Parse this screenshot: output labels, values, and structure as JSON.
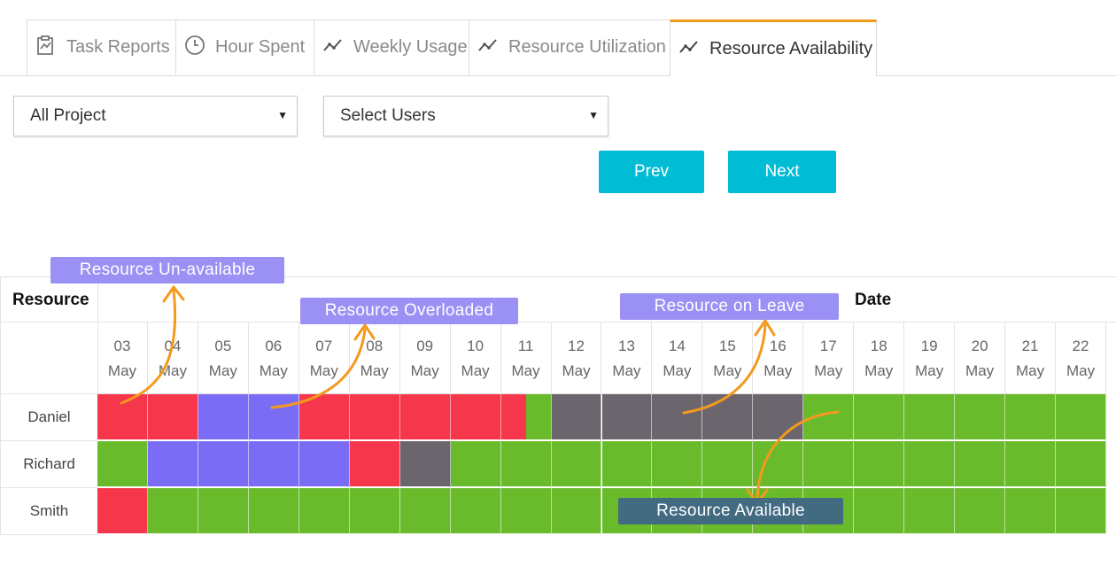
{
  "tabs": [
    {
      "label": "Task Reports",
      "icon": "task-report-icon",
      "active": false
    },
    {
      "label": "Hour Spent",
      "icon": "clock-icon",
      "active": false
    },
    {
      "label": "Weekly Usage",
      "icon": "line-chart-icon",
      "active": false
    },
    {
      "label": "Resource Utilization",
      "icon": "line-chart-icon",
      "active": false
    },
    {
      "label": "Resource Availability",
      "icon": "line-chart-icon",
      "active": true
    }
  ],
  "filters": {
    "project": {
      "value": "All Project",
      "caret": "▼"
    },
    "users": {
      "value": "Select Users",
      "caret": "▼"
    }
  },
  "buttons": {
    "prev": "Prev",
    "next": "Next"
  },
  "grid": {
    "resource_header": "Resource",
    "date_header": "Date",
    "dates": [
      {
        "day": "03",
        "month": "May"
      },
      {
        "day": "04",
        "month": "May"
      },
      {
        "day": "05",
        "month": "May"
      },
      {
        "day": "06",
        "month": "May"
      },
      {
        "day": "07",
        "month": "May"
      },
      {
        "day": "08",
        "month": "May"
      },
      {
        "day": "09",
        "month": "May"
      },
      {
        "day": "10",
        "month": "May"
      },
      {
        "day": "11",
        "month": "May"
      },
      {
        "day": "12",
        "month": "May"
      },
      {
        "day": "13",
        "month": "May"
      },
      {
        "day": "14",
        "month": "May"
      },
      {
        "day": "15",
        "month": "May"
      },
      {
        "day": "16",
        "month": "May"
      },
      {
        "day": "17",
        "month": "May"
      },
      {
        "day": "18",
        "month": "May"
      },
      {
        "day": "19",
        "month": "May"
      },
      {
        "day": "20",
        "month": "May"
      },
      {
        "day": "21",
        "month": "May"
      },
      {
        "day": "22",
        "month": "May"
      }
    ],
    "rows": [
      {
        "name": "Daniel",
        "status": [
          "U",
          "U",
          "O",
          "O",
          "U",
          "U",
          "U",
          "U",
          "U",
          "L",
          "L",
          "L",
          "L",
          "L",
          "A",
          "A",
          "A",
          "A",
          "A",
          "A"
        ],
        "partial_available_at": 8
      },
      {
        "name": "Richard",
        "status": [
          "A",
          "O",
          "O",
          "O",
          "O",
          "U",
          "L",
          "A",
          "A",
          "A",
          "A",
          "A",
          "A",
          "A",
          "A",
          "A",
          "A",
          "A",
          "A",
          "A"
        ],
        "partial_unavailable_at": 5
      },
      {
        "name": "Smith",
        "status": [
          "U",
          "A",
          "A",
          "A",
          "A",
          "A",
          "A",
          "A",
          "A",
          "A",
          "A",
          "A",
          "A",
          "A",
          "A",
          "A",
          "A",
          "A",
          "A",
          "A"
        ],
        "partial_unavailable_at": 0
      }
    ]
  },
  "status_colors": {
    "U": "#f6364a",
    "O": "#7b6cf6",
    "L": "#6b666d",
    "A": "#6abb2c"
  },
  "callouts": {
    "unavailable": {
      "label": "Resource Un-available",
      "color": "#9b90f4"
    },
    "overloaded": {
      "label": "Resource Overloaded",
      "color": "#9b90f4"
    },
    "leave": {
      "label": "Resource on Leave",
      "color": "#9b90f4"
    },
    "available": {
      "label": "Resource Available",
      "color": "#426b82"
    }
  },
  "arrow_color": "#f39a1e"
}
